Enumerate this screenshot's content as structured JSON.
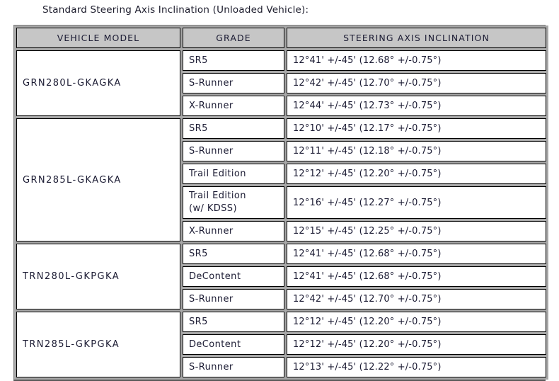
{
  "caption": "Standard Steering Axis Inclination (Unloaded Vehicle):",
  "table": {
    "headers": {
      "model": "VEHICLE MODEL",
      "grade": "GRADE",
      "sai": "STEERING AXIS INCLINATION"
    },
    "groups": [
      {
        "model": "GRN280L-GKAGKA",
        "rows": [
          {
            "grade": "SR5",
            "sai": "12°41' +/-45' (12.68° +/-0.75°)"
          },
          {
            "grade": "S-Runner",
            "sai": "12°42' +/-45' (12.70° +/-0.75°)"
          },
          {
            "grade": "X-Runner",
            "sai": "12°44' +/-45' (12.73° +/-0.75°)"
          }
        ]
      },
      {
        "model": "GRN285L-GKAGKA",
        "rows": [
          {
            "grade": "SR5",
            "sai": "12°10' +/-45' (12.17° +/-0.75°)"
          },
          {
            "grade": "S-Runner",
            "sai": "12°11' +/-45' (12.18° +/-0.75°)"
          },
          {
            "grade": "Trail Edition",
            "sai": "12°12' +/-45' (12.20° +/-0.75°)"
          },
          {
            "grade": "Trail Edition\n(w/ KDSS)",
            "sai": "12°16' +/-45' (12.27° +/-0.75°)",
            "two_line": true
          },
          {
            "grade": "X-Runner",
            "sai": "12°15' +/-45' (12.25° +/-0.75°)"
          }
        ]
      },
      {
        "model": "TRN280L-GKPGKA",
        "rows": [
          {
            "grade": "SR5",
            "sai": "12°41' +/-45' (12.68° +/-0.75°)"
          },
          {
            "grade": "DeContent",
            "sai": "12°41' +/-45' (12.68° +/-0.75°)"
          },
          {
            "grade": "S-Runner",
            "sai": "12°42' +/-45' (12.70° +/-0.75°)"
          }
        ]
      },
      {
        "model": "TRN285L-GKPGKA",
        "rows": [
          {
            "grade": "SR5",
            "sai": "12°12' +/-45' (12.20° +/-0.75°)"
          },
          {
            "grade": "DeContent",
            "sai": "12°12' +/-45' (12.20° +/-0.75°)"
          },
          {
            "grade": "S-Runner",
            "sai": "12°13' +/-45' (12.22° +/-0.75°)"
          }
        ]
      }
    ]
  },
  "colors": {
    "header_bg": "#c6c6c6",
    "table_bg": "#a8a8a8",
    "cell_bg": "#ffffff",
    "text": "#1b1b33",
    "border": "#000000"
  }
}
